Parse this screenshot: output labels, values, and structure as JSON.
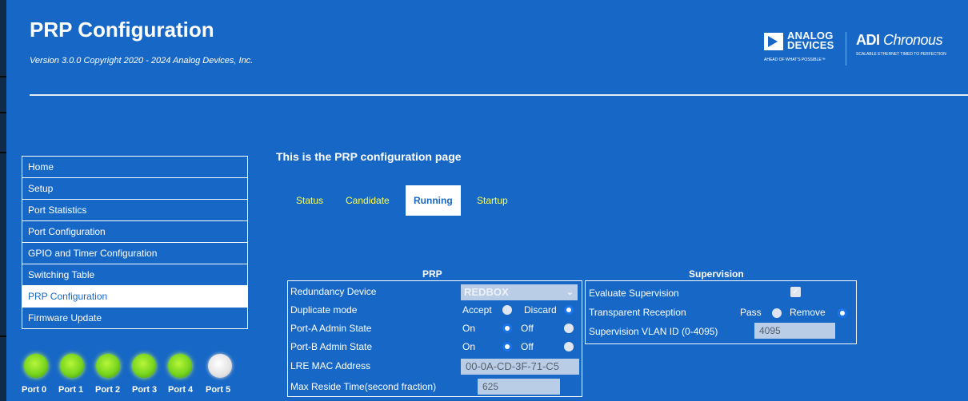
{
  "header": {
    "title": "PRP Configuration",
    "version": "Version 3.0.0 Copyright 2020 - 2024 Analog Devices, Inc.",
    "logo_ad_line1": "ANALOG",
    "logo_ad_line2": "DEVICES",
    "logo_ad_tagline": "AHEAD OF WHAT'S POSSIBLE™",
    "logo_chronous_name": "ADI",
    "logo_chronous_italic": "Chronous",
    "logo_chronous_tagline": "SCALABLE ETHERNET TIMED TO PERFECTION"
  },
  "sidebar": {
    "items": [
      {
        "label": "Home"
      },
      {
        "label": "Setup"
      },
      {
        "label": "Port Statistics"
      },
      {
        "label": "Port Configuration"
      },
      {
        "label": "GPIO and Timer Configuration"
      },
      {
        "label": "Switching Table"
      },
      {
        "label": "PRP Configuration",
        "active": true
      },
      {
        "label": "Firmware Update"
      }
    ]
  },
  "ports": [
    {
      "label": "Port 0",
      "state": "on"
    },
    {
      "label": "Port 1",
      "state": "on"
    },
    {
      "label": "Port 2",
      "state": "on"
    },
    {
      "label": "Port 3",
      "state": "on"
    },
    {
      "label": "Port 4",
      "state": "on"
    },
    {
      "label": "Port 5",
      "state": "off"
    }
  ],
  "main": {
    "heading": "This is the PRP configuration page",
    "tabs": [
      {
        "label": "Status"
      },
      {
        "label": "Candidate"
      },
      {
        "label": "Running",
        "active": true
      },
      {
        "label": "Startup"
      }
    ]
  },
  "prp": {
    "title": "PRP",
    "redundancy_device": {
      "label": "Redundancy Device",
      "value": "REDBOX"
    },
    "duplicate_mode": {
      "label": "Duplicate mode",
      "opt1": "Accept",
      "opt2": "Discard",
      "selected": "Discard"
    },
    "port_a_admin": {
      "label": "Port-A Admin State",
      "opt1": "On",
      "opt2": "Off",
      "selected": "On"
    },
    "port_b_admin": {
      "label": "Port-B Admin State",
      "opt1": "On",
      "opt2": "Off",
      "selected": "On"
    },
    "lre_mac": {
      "label": "LRE MAC Address",
      "value": "00-0A-CD-3F-71-C5"
    },
    "max_reside": {
      "label": "Max Reside Time(second fraction)",
      "value": "625"
    }
  },
  "supervision": {
    "title": "Supervision",
    "evaluate": {
      "label": "Evaluate Supervision",
      "checked": true
    },
    "transparent": {
      "label": "Transparent Reception",
      "opt1": "Pass",
      "opt2": "Remove",
      "selected": "Remove"
    },
    "vlan": {
      "label": "Supervision VLAN ID (0-4095)",
      "value": "4095"
    }
  },
  "colors": {
    "background": "#1768c6",
    "tab_text": "#ffff4d",
    "led_on": "#78d61e",
    "led_off": "#e3e3e3"
  }
}
